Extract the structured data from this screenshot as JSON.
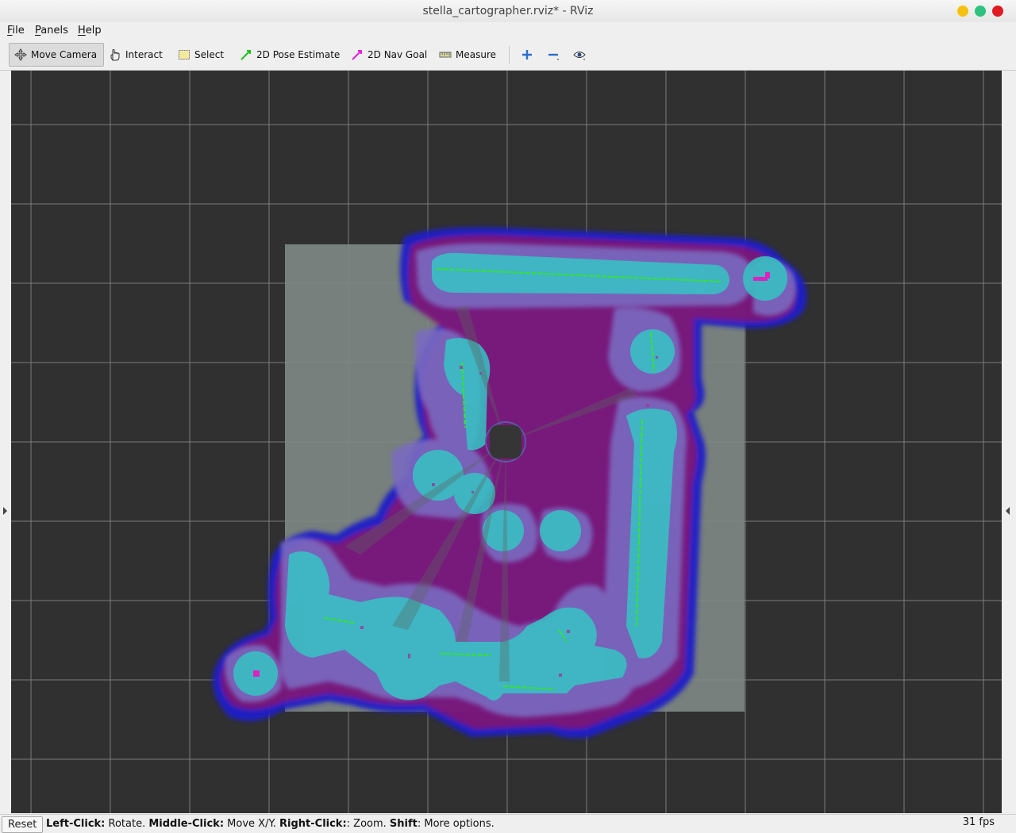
{
  "window": {
    "title": "stella_cartographer.rviz* - RViz"
  },
  "menu": {
    "items": [
      "File",
      "Panels",
      "Help"
    ]
  },
  "toolbar": {
    "move_camera": "Move Camera",
    "interact": "Interact",
    "select": "Select",
    "pose_estimate": "2D Pose Estimate",
    "nav_goal": "2D Nav Goal",
    "measure": "Measure"
  },
  "status": {
    "reset": "Reset",
    "left_click_key": "Left-Click:",
    "left_click_val": " Rotate. ",
    "middle_click_key": "Middle-Click:",
    "middle_click_val": " Move X/Y. ",
    "right_click_key": "Right-Click:",
    "right_click_val": ": Zoom. ",
    "shift_key": "Shift",
    "shift_val": ": More options.",
    "fps": "31 fps"
  },
  "colors": {
    "viewport_bg": "#303030",
    "grid": "#8a8a8a",
    "map_free": "#7f8a85",
    "costmap_cyan": "#36c4c4",
    "costmap_purple": "#7a6ac0",
    "costmap_blue": "#2020c8",
    "costmap_red": "#c01040",
    "scan_green": "#38e038"
  }
}
